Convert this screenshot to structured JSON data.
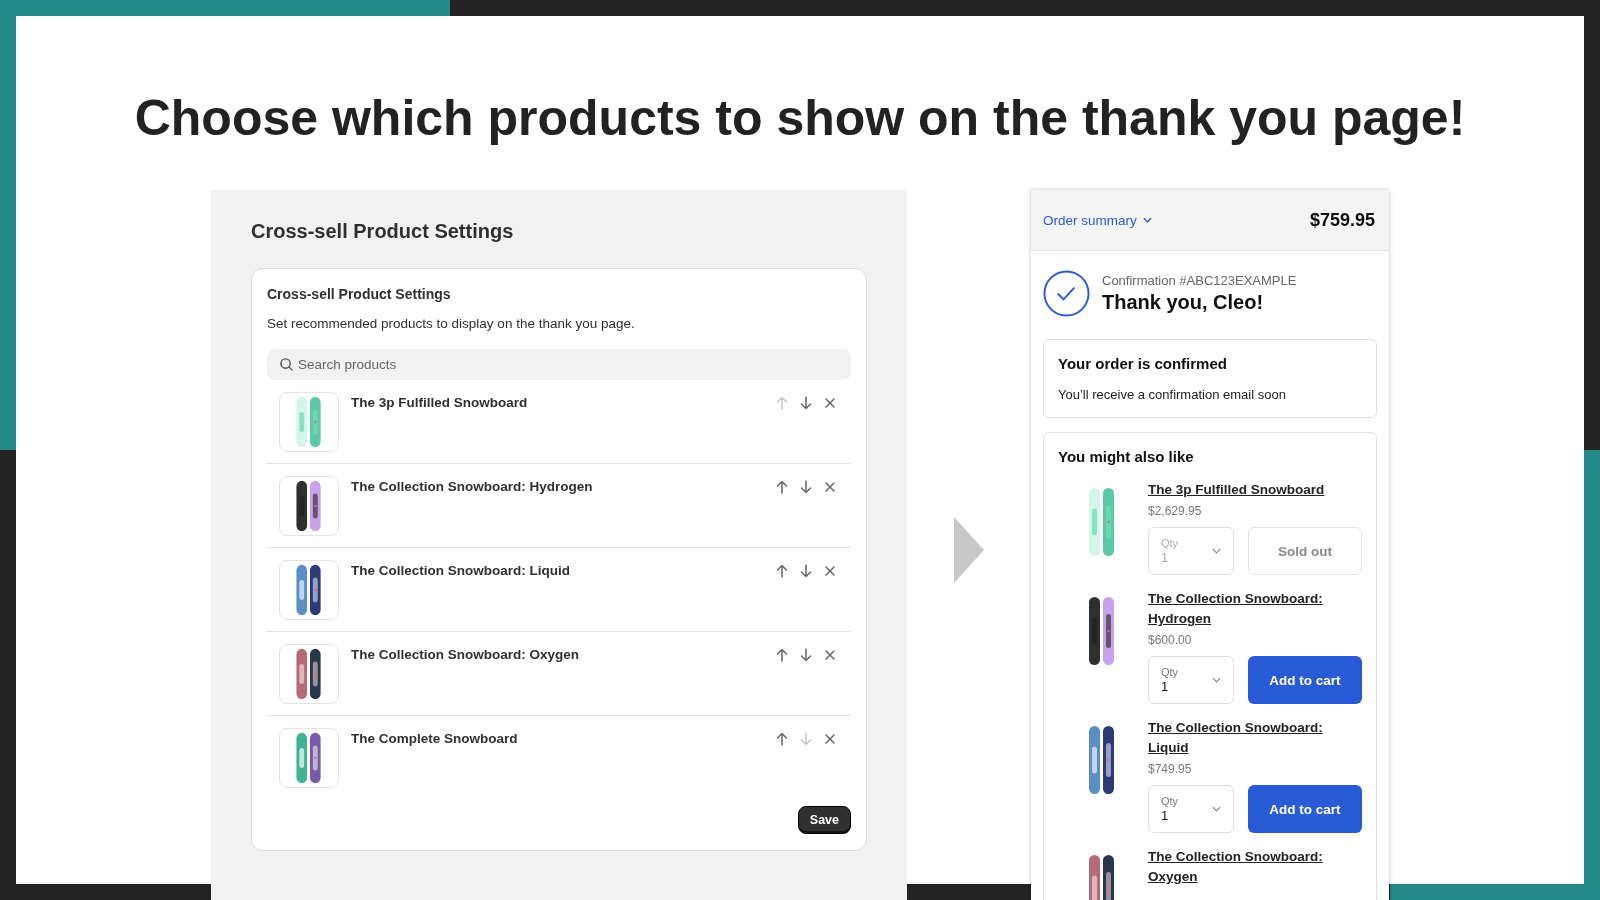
{
  "headline": "Choose which products to show on the thank you page!",
  "settings": {
    "page_title": "Cross-sell Product Settings",
    "card_title": "Cross-sell Product Settings",
    "description": "Set recommended products to display on the thank you page.",
    "search": {
      "placeholder": "Search products"
    },
    "products": [
      {
        "name": "The 3p Fulfilled Snowboard",
        "up_disabled": true,
        "down_disabled": false
      },
      {
        "name": "The Collection Snowboard: Hydrogen",
        "up_disabled": false,
        "down_disabled": false
      },
      {
        "name": "The Collection Snowboard: Liquid",
        "up_disabled": false,
        "down_disabled": false
      },
      {
        "name": "The Collection Snowboard: Oxygen",
        "up_disabled": false,
        "down_disabled": false
      },
      {
        "name": "The Complete Snowboard",
        "up_disabled": false,
        "down_disabled": true
      }
    ],
    "save_button": "Save"
  },
  "checkout": {
    "summary_link": "Order summary",
    "total": "$759.95",
    "confirmation": "Confirmation #ABC123EXAMPLE",
    "thanks": "Thank you, Cleo!",
    "confirmed_card": {
      "title": "Your order is confirmed",
      "text": "You’ll receive a confirmation email soon"
    },
    "recommendations": {
      "title": "You might also like",
      "items": [
        {
          "name": "The 3p Fulfilled Snowboard",
          "price": "$2,629.95",
          "qty_label": "Qty",
          "qty": "1",
          "button": "Sold out",
          "disabled": true
        },
        {
          "name": "The Collection Snowboard: Hydrogen",
          "price": "$600.00",
          "qty_label": "Qty",
          "qty": "1",
          "button": "Add to cart",
          "disabled": false
        },
        {
          "name": "The Collection Snowboard: Liquid",
          "price": "$749.95",
          "qty_label": "Qty",
          "qty": "1",
          "button": "Add to cart",
          "disabled": false
        },
        {
          "name": "The Collection Snowboard: Oxygen"
        }
      ]
    }
  }
}
